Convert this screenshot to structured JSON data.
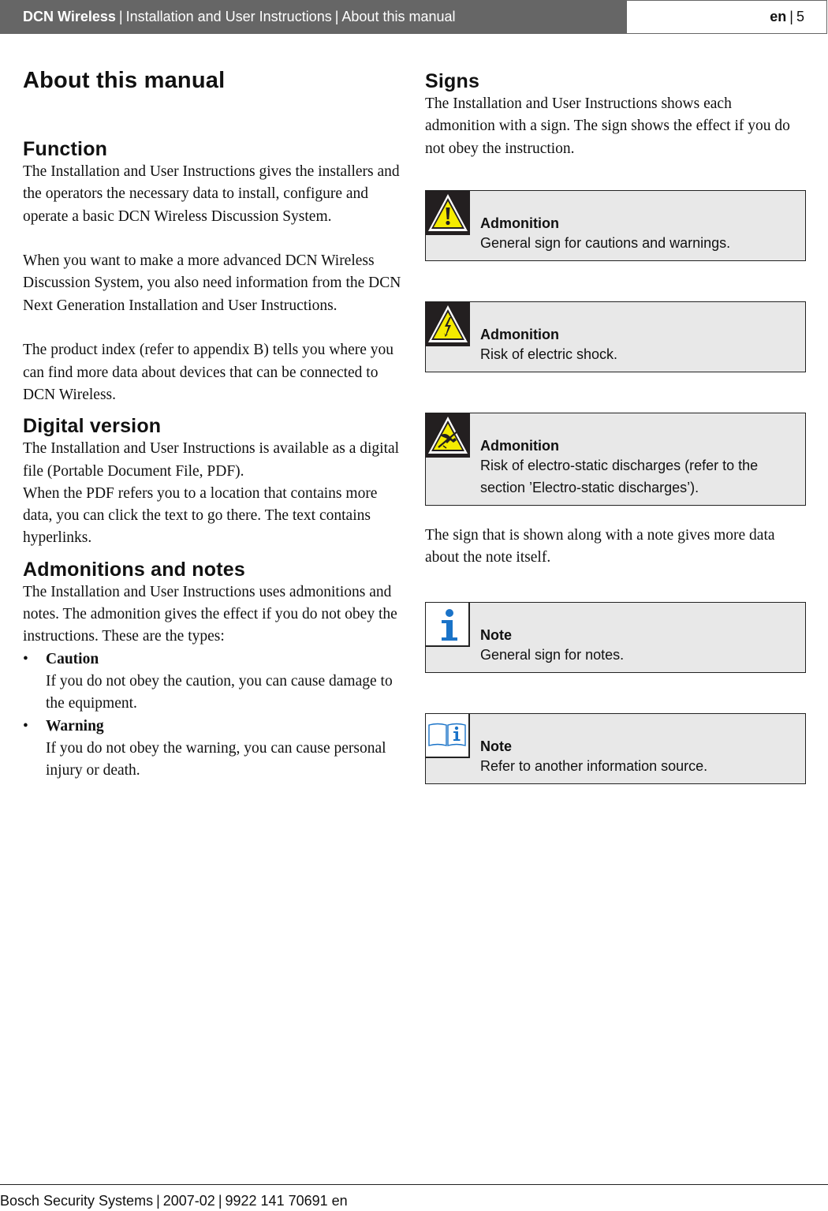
{
  "header": {
    "product": "DCN Wireless",
    "document": "Installation and User Instructions",
    "section": "About this manual",
    "language": "en",
    "page_number": "5",
    "separator": "|"
  },
  "left_column": {
    "title": "About this manual",
    "function": {
      "heading": "Function",
      "paragraphs": [
        "The Installation and User Instructions gives the installers and the operators the necessary data to install, configure and operate a basic DCN Wireless Discussion System.",
        "When you want to make a more advanced DCN Wireless Discussion System, you also need information from the DCN Next Generation Installation and User Instructions.",
        "The product index (refer to appendix B) tells you where you can find more data about devices that can be connected to DCN Wireless."
      ]
    },
    "digital_version": {
      "heading": "Digital version",
      "paragraphs": [
        "The Installation and User Instructions is available as a digital file (Portable Document File, PDF).",
        "When the PDF refers you to a location that contains more data, you can click the text to go there. The text contains hyperlinks."
      ]
    },
    "admonitions_notes": {
      "heading": "Admonitions and notes",
      "intro": "The Installation and User Instructions uses admonitions and notes. The admonition gives the effect if you do not obey the instructions. These are the types:",
      "bullet_char": "•",
      "types": [
        {
          "label": "Caution",
          "description": "If you do not obey the caution, you can cause damage to the equipment."
        },
        {
          "label": "Warning",
          "description": "If you do not obey the warning, you can cause personal injury or death."
        }
      ]
    }
  },
  "right_column": {
    "signs": {
      "heading": "Signs",
      "intro": "The Installation and User Instructions shows each admonition with a sign. The sign shows the effect if you do not obey the instruction.",
      "admonitions": [
        {
          "icon": "warning-triangle-exclamation-icon",
          "title": "Admonition",
          "text": "General sign for cautions and warnings."
        },
        {
          "icon": "electric-shock-icon",
          "title": "Admonition",
          "text": "Risk of electric shock."
        },
        {
          "icon": "esd-hazard-icon",
          "title": "Admonition",
          "text": "Risk of electro-static discharges (refer to the section ’Electro-static discharges’)."
        }
      ],
      "note_intro": "The sign that is shown along with a note gives more data about the note itself.",
      "notes": [
        {
          "icon": "info-icon",
          "title": "Note",
          "text": "General sign for notes."
        },
        {
          "icon": "book-info-icon",
          "title": "Note",
          "text": "Refer to another information source."
        }
      ]
    }
  },
  "footer": {
    "company": "Bosch Security Systems",
    "date": "2007-02",
    "doc_number": "9922 141 70691 en",
    "separator": "|"
  },
  "colors": {
    "header_bg": "#666666",
    "box_bg": "#e8e8e8",
    "warning_yellow": "#f5eb00",
    "icon_dark_bg": "#231f20",
    "note_blue": "#1a73c8"
  }
}
